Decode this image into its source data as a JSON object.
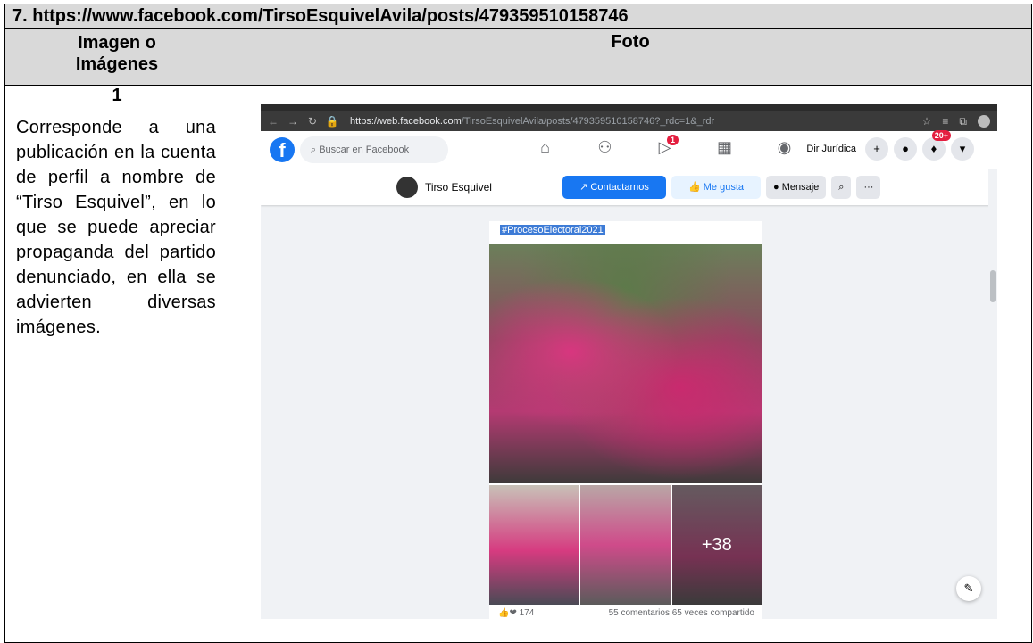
{
  "doc": {
    "title": "7. https://www.facebook.com/TirsoEsquivelAvila/posts/479359510158746",
    "header_left_1": "Imagen o",
    "header_left_2": "Imágenes",
    "header_right": "Foto",
    "row_number": "1",
    "description": "Corresponde a una publicación en la cuenta de perfil a nombre de “Tirso Esquivel”, en lo que se puede apreciar propaganda del partido denunciado, en ella se advierten diversas imágenes."
  },
  "screenshot": {
    "url_domain": "https://web.facebook.com",
    "url_path": "/TirsoEsquivelAvila/posts/479359510158746?_rdc=1&_rdr",
    "search_placeholder": "Buscar en Facebook",
    "video_badge": "1",
    "account_name": "Dir Jurídica",
    "notif_badge": "20+",
    "page_name": "Tirso Esquivel",
    "contact_button": "Contactarnos",
    "like_button": "Me gusta",
    "message_button": "Mensaje",
    "more_button": "···",
    "hashtag": "#ProcesoElectoral2021",
    "more_photos": "+38",
    "reaction_count": "174",
    "comments_shares": "55 comentarios 65 veces compartido"
  }
}
